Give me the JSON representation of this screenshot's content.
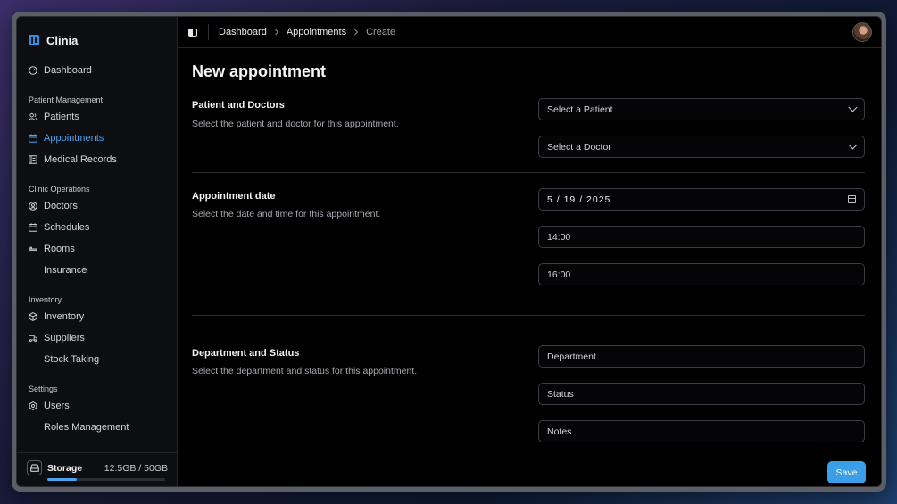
{
  "app": {
    "name": "Clinia"
  },
  "sidebar": {
    "top_item": {
      "label": "Dashboard",
      "icon": "dashboard-icon"
    },
    "sections": [
      {
        "label": "Patient Management",
        "items": [
          {
            "label": "Patients",
            "icon": "users-icon",
            "active": false
          },
          {
            "label": "Appointments",
            "icon": "calendar-icon",
            "active": true
          },
          {
            "label": "Medical Records",
            "icon": "file-icon",
            "active": false
          }
        ]
      },
      {
        "label": "Clinic Operations",
        "items": [
          {
            "label": "Doctors",
            "icon": "user-circle-icon"
          },
          {
            "label": "Schedules",
            "icon": "calendar-icon"
          },
          {
            "label": "Rooms",
            "icon": "bed-icon"
          },
          {
            "label": "Insurance",
            "icon": ""
          }
        ]
      },
      {
        "label": "Inventory",
        "items": [
          {
            "label": "Inventory",
            "icon": "box-icon"
          },
          {
            "label": "Suppliers",
            "icon": "truck-icon"
          },
          {
            "label": "Stock Taking",
            "icon": ""
          }
        ]
      },
      {
        "label": "Settings",
        "items": [
          {
            "label": "Users",
            "icon": "gear-icon"
          },
          {
            "label": "Roles Management",
            "icon": ""
          }
        ]
      }
    ],
    "storage": {
      "label": "Storage",
      "value": "12.5GB / 50GB",
      "used_fraction": 0.25
    }
  },
  "breadcrumb": [
    "Dashboard",
    "Appointments",
    "Create"
  ],
  "page": {
    "title": "New appointment",
    "sections": [
      {
        "title": "Patient and Doctors",
        "description": "Select the patient and doctor for this appointment."
      },
      {
        "title": "Appointment date",
        "description": "Select the date and time for this appointment."
      },
      {
        "title": "Department and Status",
        "description": "Select the department and status for this appointment."
      }
    ],
    "fields": {
      "patient_select": "Select a Patient",
      "doctor_select": "Select a Doctor",
      "date": "5 / 19 / 2025",
      "start_time": "14:00",
      "end_time": "16:00",
      "department": "Department",
      "status": "Status",
      "notes": "Notes"
    },
    "save_label": "Save"
  },
  "colors": {
    "accent": "#4aa3ef",
    "button": "#3b9ee8",
    "background": "#000000"
  }
}
